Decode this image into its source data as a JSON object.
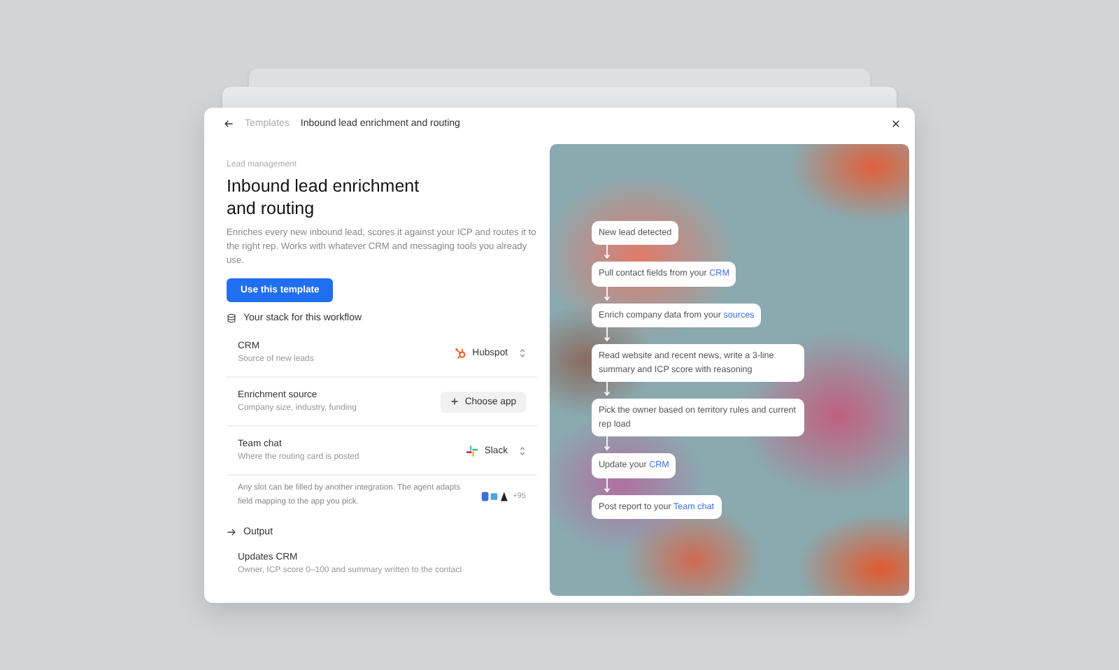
{
  "breadcrumb": {
    "parent": "Templates",
    "current": "Inbound lead enrichment and routing"
  },
  "category": "Lead management",
  "title": "Inbound lead enrichment and routing",
  "description": "Enriches every new inbound lead, scores it against your ICP and routes it to the right rep. Works with whatever CRM and messaging tools you already use.",
  "primary_button": "Use this template",
  "stack": {
    "heading": "Your stack for this workflow",
    "slots": [
      {
        "kind": "sprocket",
        "name": "CRM",
        "hint": "Source of new leads",
        "app": "Hubspot"
      },
      {
        "kind": "choose",
        "name": "Enrichment source",
        "hint": "Company size, industry, funding",
        "action": "Choose app"
      },
      {
        "kind": "hash",
        "name": "Team chat",
        "hint": "Where the routing card is posted",
        "app": "Slack"
      }
    ],
    "note": "Any slot can be filled by another integration. The agent adapts field mapping to the app you pick.",
    "more_count": "+95"
  },
  "output": {
    "heading": "Output",
    "items": [
      {
        "name": "Updates CRM",
        "hint": "Owner, ICP score 0–100 and summary written to the contact"
      }
    ]
  },
  "flow": [
    {
      "text": "New lead detected"
    },
    {
      "text": "Pull contact fields from your ",
      "link": "CRM"
    },
    {
      "text": "Enrich company data from your ",
      "link": "sources"
    },
    {
      "text": "Read website and recent news, write a 3-line summary and ICP score with reasoning"
    },
    {
      "text": "Pick the owner based on territory rules and current rep load"
    },
    {
      "text": "Update your ",
      "link": "CRM"
    },
    {
      "text": "Post report to your ",
      "link": "Team chat"
    }
  ]
}
